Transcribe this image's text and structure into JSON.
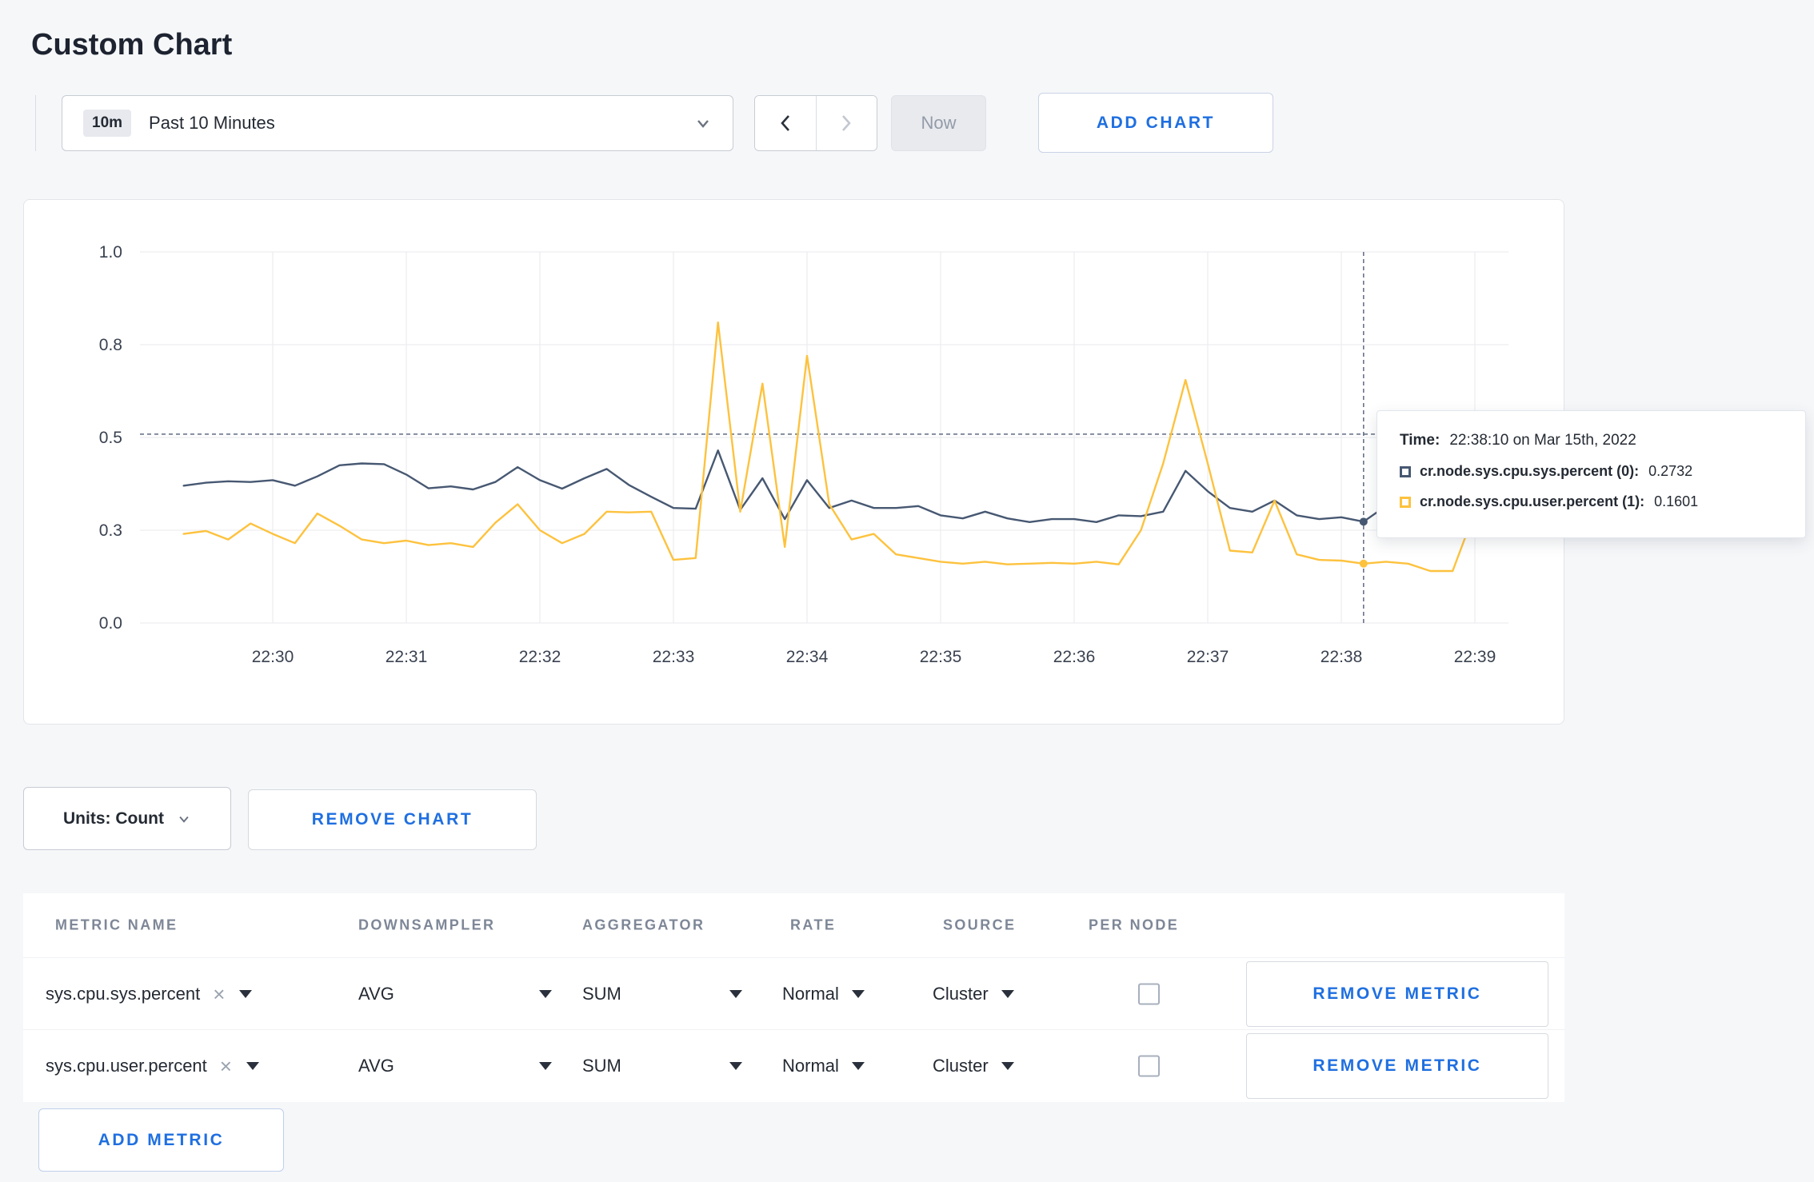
{
  "page": {
    "title": "Custom Chart",
    "accent": "#1f6fe0",
    "background": "#f6f7f9"
  },
  "toolbar": {
    "time_range": {
      "badge": "10m",
      "label": "Past 10 Minutes"
    },
    "now_label": "Now",
    "add_chart_label": "ADD CHART"
  },
  "chart_data": {
    "type": "line",
    "title": "",
    "xlabel": "",
    "ylabel": "",
    "ylim": [
      0,
      1
    ],
    "grid": true,
    "x_axis": {
      "tick_labels": [
        "22:30",
        "22:31",
        "22:32",
        "22:33",
        "22:34",
        "22:35",
        "22:36",
        "22:37",
        "22:38",
        "22:39"
      ],
      "start_offset_seconds": -40,
      "step_seconds": 10
    },
    "y_axis": {
      "ticks": [
        {
          "label": "0.0",
          "value": 0
        },
        {
          "label": "0.3",
          "value": 0.25
        },
        {
          "label": "0.5",
          "value": 0.5
        },
        {
          "label": "0.8",
          "value": 0.75
        },
        {
          "label": "1.0",
          "value": 1.0
        }
      ]
    },
    "series": [
      {
        "name": "cr.node.sys.cpu.sys.percent",
        "color": "#475872",
        "values": [
          0.37,
          0.378,
          0.382,
          0.38,
          0.385,
          0.37,
          0.395,
          0.425,
          0.43,
          0.428,
          0.4,
          0.363,
          0.368,
          0.36,
          0.38,
          0.42,
          0.385,
          0.362,
          0.39,
          0.415,
          0.372,
          0.34,
          0.31,
          0.308,
          0.465,
          0.305,
          0.39,
          0.28,
          0.385,
          0.31,
          0.33,
          0.31,
          0.31,
          0.315,
          0.29,
          0.282,
          0.3,
          0.282,
          0.272,
          0.28,
          0.28,
          0.272,
          0.29,
          0.288,
          0.3,
          0.41,
          0.355,
          0.31,
          0.3,
          0.33,
          0.29,
          0.28,
          0.285,
          0.273,
          0.315,
          0.3,
          0.298,
          0.31,
          0.302,
          0.308
        ]
      },
      {
        "name": "cr.node.sys.cpu.user.percent",
        "color": "#fdc23e",
        "values": [
          0.24,
          0.248,
          0.225,
          0.268,
          0.24,
          0.215,
          0.295,
          0.262,
          0.225,
          0.215,
          0.222,
          0.21,
          0.215,
          0.205,
          0.27,
          0.32,
          0.25,
          0.215,
          0.24,
          0.3,
          0.298,
          0.3,
          0.17,
          0.175,
          0.81,
          0.3,
          0.645,
          0.205,
          0.72,
          0.32,
          0.225,
          0.24,
          0.185,
          0.175,
          0.165,
          0.16,
          0.165,
          0.158,
          0.16,
          0.162,
          0.16,
          0.165,
          0.158,
          0.25,
          0.43,
          0.655,
          0.43,
          0.195,
          0.19,
          0.33,
          0.185,
          0.17,
          0.168,
          0.16,
          0.165,
          0.16,
          0.14,
          0.14,
          0.3,
          0.232
        ]
      }
    ],
    "crosshair": {
      "index": 53,
      "time": "22:38:10",
      "hline_value": 0.509
    }
  },
  "tooltip": {
    "time_label": "Time:",
    "time_value": "22:38:10 on Mar 15th, 2022",
    "entries": [
      {
        "name": "cr.node.sys.cpu.sys.percent (0):",
        "value": "0.2732",
        "color": "#475872"
      },
      {
        "name": "cr.node.sys.cpu.user.percent (1):",
        "value": "0.1601",
        "color": "#fdc23e"
      }
    ]
  },
  "chart_footer": {
    "units_label": "Units: Count",
    "remove_chart_label": "REMOVE CHART"
  },
  "metrics_table": {
    "headers": [
      "METRIC NAME",
      "DOWNSAMPLER",
      "AGGREGATOR",
      "RATE",
      "SOURCE",
      "PER NODE"
    ],
    "rows": [
      {
        "metric": "sys.cpu.sys.percent",
        "downsampler": "AVG",
        "aggregator": "SUM",
        "rate": "Normal",
        "source": "Cluster",
        "per_node": false,
        "remove_label": "REMOVE METRIC"
      },
      {
        "metric": "sys.cpu.user.percent",
        "downsampler": "AVG",
        "aggregator": "SUM",
        "rate": "Normal",
        "source": "Cluster",
        "per_node": false,
        "remove_label": "REMOVE METRIC"
      }
    ],
    "add_metric_label": "ADD METRIC"
  }
}
